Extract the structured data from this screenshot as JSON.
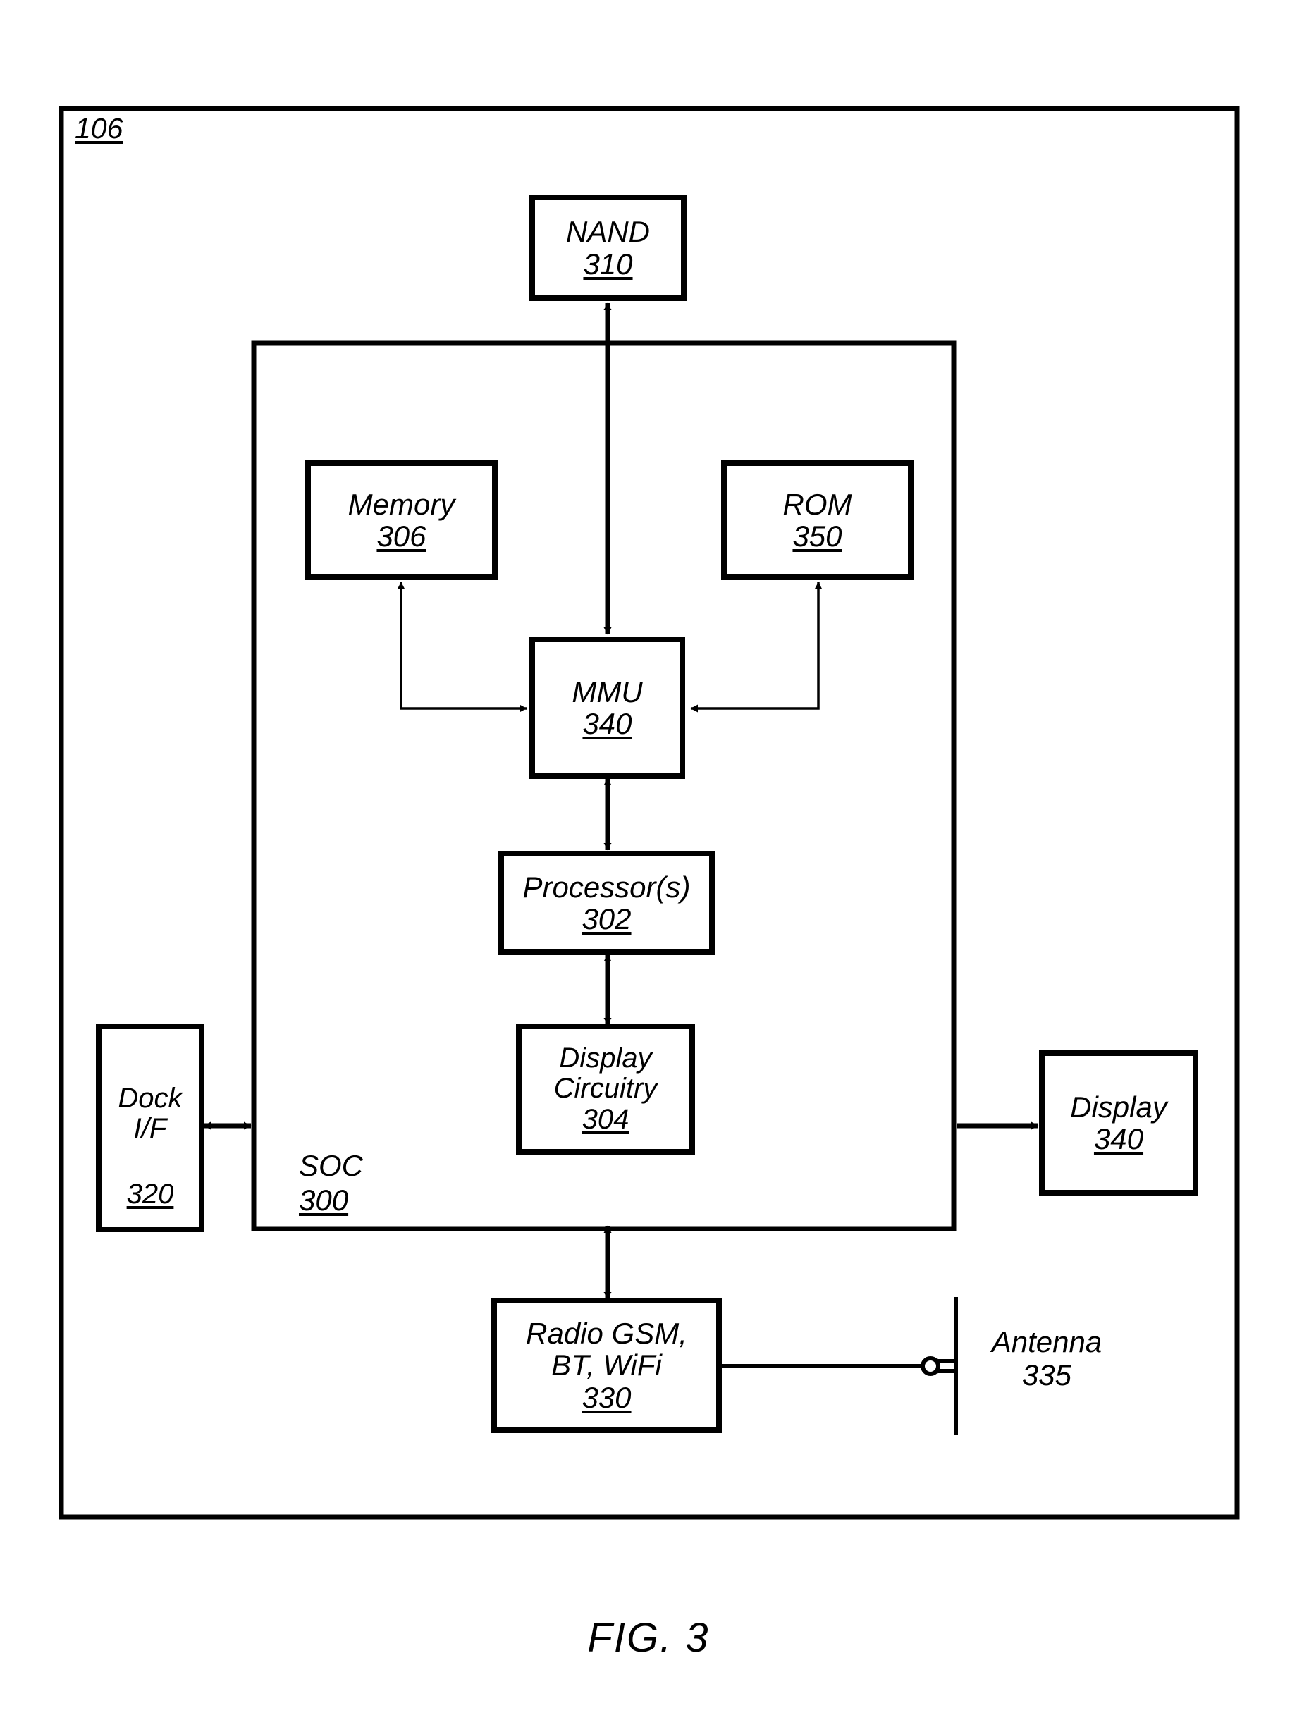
{
  "figure": {
    "caption": "FIG. 3",
    "outer_label": "106"
  },
  "blocks": {
    "nand": {
      "title": "NAND",
      "ref": "310"
    },
    "memory": {
      "title": "Memory",
      "ref": "306"
    },
    "rom": {
      "title": "ROM",
      "ref": "350"
    },
    "mmu": {
      "title": "MMU",
      "ref": "340"
    },
    "processor": {
      "title": "Processor(s)",
      "ref": "302"
    },
    "display_circuitry": {
      "line1": "Display",
      "line2": "Circuitry",
      "ref": "304"
    },
    "dock": {
      "line1": "Dock",
      "line2": "I/F",
      "ref": "320"
    },
    "soc": {
      "title": "SOC",
      "ref": "300"
    },
    "display": {
      "title": "Display",
      "ref": "340"
    },
    "radio": {
      "line1": "Radio GSM,",
      "line2": "BT, WiFi",
      "ref": "330"
    },
    "antenna": {
      "title": "Antenna",
      "ref": "335"
    }
  },
  "connections": [
    {
      "name": "nand-to-mmu",
      "from": "nand",
      "to": "mmu",
      "arrow": "double"
    },
    {
      "name": "memory-to-mmu",
      "from": "memory",
      "to": "mmu",
      "arrow": "double"
    },
    {
      "name": "rom-to-mmu",
      "from": "rom",
      "to": "mmu",
      "arrow": "double"
    },
    {
      "name": "mmu-to-processor",
      "from": "mmu",
      "to": "processor",
      "arrow": "double"
    },
    {
      "name": "processor-to-display-circuitry",
      "from": "processor",
      "to": "display_circuitry",
      "arrow": "double"
    },
    {
      "name": "dock-to-soc",
      "from": "dock",
      "to": "soc",
      "arrow": "double"
    },
    {
      "name": "soc-to-display",
      "from": "soc",
      "to": "display",
      "arrow": "single"
    },
    {
      "name": "soc-to-radio",
      "from": "soc",
      "to": "radio",
      "arrow": "double"
    },
    {
      "name": "radio-to-antenna",
      "from": "radio",
      "to": "antenna",
      "arrow": "none"
    }
  ],
  "colors": {
    "stroke": "#000000",
    "fill": "#ffffff",
    "background": "#ffffff"
  }
}
